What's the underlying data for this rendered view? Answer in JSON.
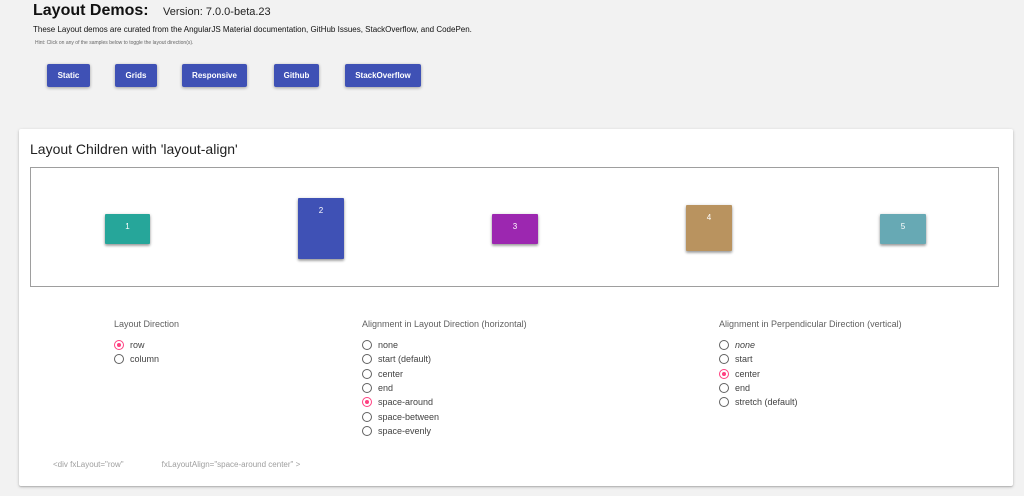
{
  "header": {
    "title": "Layout Demos:",
    "version": "Version: 7.0.0-beta.23",
    "description": "These Layout demos are curated from the AngularJS Material documentation, GitHub Issues, StackOverflow, and CodePen.",
    "hint": "Hint: Click on any of the samples below to toggle the layout direction(s)."
  },
  "nav": {
    "buttons": [
      "Static",
      "Grids",
      "Responsive",
      "Github",
      "StackOverflow"
    ]
  },
  "card": {
    "title": "Layout Children with 'layout-align'",
    "children": [
      {
        "label": "1",
        "color": "#26a69a"
      },
      {
        "label": "2",
        "color": "#3f51b5"
      },
      {
        "label": "3",
        "color": "#9c27b0"
      },
      {
        "label": "4",
        "color": "#b9935f"
      },
      {
        "label": "5",
        "color": "#67a9b4"
      }
    ]
  },
  "controls": {
    "direction": {
      "title": "Layout Direction",
      "options": [
        "row",
        "column"
      ],
      "selected": "row"
    },
    "main_axis": {
      "title": "Alignment in Layout Direction (horizontal)",
      "options": [
        "none",
        "start (default)",
        "center",
        "end",
        "space-around",
        "space-between",
        "space-evenly"
      ],
      "selected": "space-around"
    },
    "cross_axis": {
      "title": "Alignment in Perpendicular Direction (vertical)",
      "options": [
        "none",
        "start",
        "center",
        "end",
        "stretch (default)"
      ],
      "selected": "center"
    }
  },
  "code": {
    "part1": "<div fxLayout=\"row\"",
    "part2": "fxLayoutAlign=\"space-around center\" >"
  },
  "colors": {
    "accent": "#ff4081",
    "primary": "#3f51b5"
  }
}
